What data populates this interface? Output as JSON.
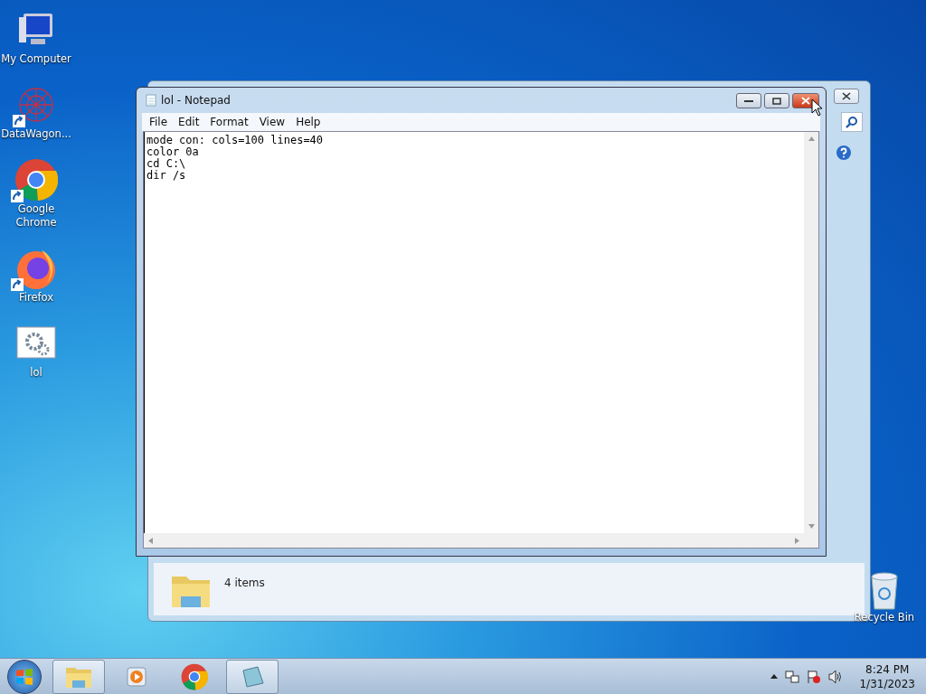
{
  "desktop_icons": [
    {
      "label": "My Computer",
      "kind": "computer",
      "shortcut": false
    },
    {
      "label": "DataWagon...",
      "kind": "network",
      "shortcut": true
    },
    {
      "label": "Google Chrome",
      "kind": "chrome",
      "shortcut": true
    },
    {
      "label": "Firefox",
      "kind": "firefox",
      "shortcut": true
    },
    {
      "label": "lol",
      "kind": "script",
      "shortcut": false
    }
  ],
  "recycle_bin": {
    "label": "Recycle Bin"
  },
  "explorer_window": {
    "status": "4 items"
  },
  "notepad": {
    "title": "lol - Notepad",
    "menu": [
      "File",
      "Edit",
      "Format",
      "View",
      "Help"
    ],
    "lines": [
      "mode con: cols=100 lines=40",
      "color 0a",
      "cd C:\\",
      "dir /s"
    ]
  },
  "taskbar": {
    "items": [
      {
        "kind": "explorer",
        "running": true
      },
      {
        "kind": "media",
        "running": false
      },
      {
        "kind": "chrome",
        "running": false
      },
      {
        "kind": "notepad",
        "running": true
      }
    ],
    "time": "8:24 PM",
    "date": "1/31/2023"
  }
}
